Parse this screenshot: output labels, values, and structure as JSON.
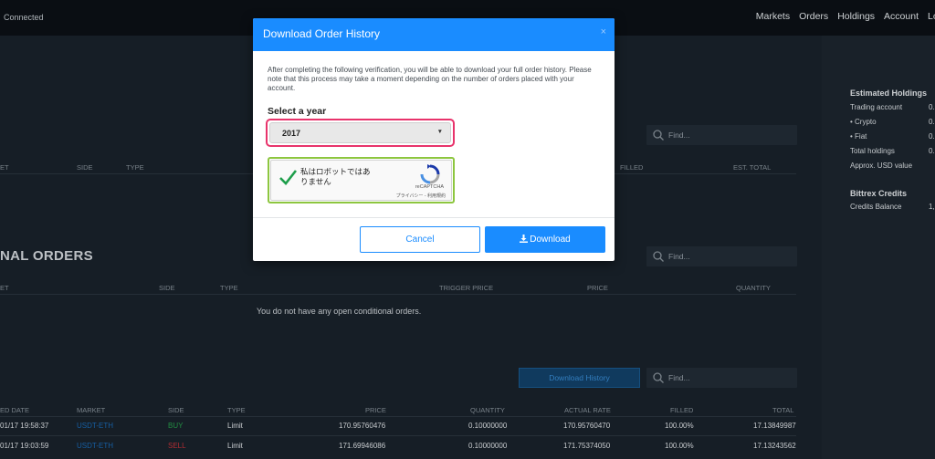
{
  "header": {
    "status": "Connected",
    "nav": [
      "Markets",
      "Orders",
      "Holdings",
      "Account",
      "Lo"
    ]
  },
  "open_orders": {
    "search_placeholder": "Find...",
    "columns": [
      "ET",
      "SIDE",
      "TYPE",
      "FILLED",
      "EST. TOTAL"
    ]
  },
  "conditional_orders": {
    "title": "NAL ORDERS",
    "search_placeholder": "Find...",
    "columns": [
      "ET",
      "SIDE",
      "TYPE",
      "TRIGGER PRICE",
      "PRICE",
      "QUANTITY"
    ],
    "empty": "You do not have any open conditional orders."
  },
  "history": {
    "download_label": "Download History",
    "search_placeholder": "Find...",
    "columns": [
      "ED DATE",
      "MARKET",
      "SIDE",
      "TYPE",
      "PRICE",
      "QUANTITY",
      "ACTUAL RATE",
      "FILLED",
      "TOTAL"
    ],
    "rows": [
      {
        "date": "01/17 19:58:37",
        "market": "USDT-ETH",
        "side": "BUY",
        "type": "Limit",
        "price": "170.95760476",
        "quantity": "0.10000000",
        "rate": "170.95760470",
        "filled": "100.00%",
        "total": "17.13849987"
      },
      {
        "date": "01/17 19:03:59",
        "market": "USDT-ETH",
        "side": "SELL",
        "type": "Limit",
        "price": "171.69946086",
        "quantity": "0.10000000",
        "rate": "171.75374050",
        "filled": "100.00%",
        "total": "17.13243562"
      }
    ]
  },
  "right_panel": {
    "holdings_title": "Estimated Holdings",
    "holdings": [
      {
        "label": "Trading account",
        "value": "0."
      },
      {
        "label": "• Crypto",
        "value": "0."
      },
      {
        "label": "• Fiat",
        "value": "0."
      },
      {
        "label": "Total holdings",
        "value": "0."
      },
      {
        "label": "Approx. USD value",
        "value": ""
      }
    ],
    "credits_title": "Bittrex Credits",
    "credits": [
      {
        "label": "Credits Balance",
        "value": "1,"
      }
    ]
  },
  "modal": {
    "title": "Download Order History",
    "close": "×",
    "description": "After completing the following verification, you will be able to download your full order history. Please note that this process may take a moment depending on the number of orders placed with your account.",
    "select_label": "Select a year",
    "select_value": "2017",
    "captcha_text": "私はロボットではありません",
    "captcha_brand": "reCAPTCHA",
    "captcha_links": "プライバシー - 利用規約",
    "cancel_label": "Cancel",
    "download_label": "Download"
  },
  "colors": {
    "accent": "#1a8cff",
    "buy": "#27a04b",
    "sell": "#c8333a",
    "highlight_select": "#e8336b",
    "highlight_captcha": "#8dc63f"
  },
  "icons": [
    "search-icon",
    "close-icon",
    "chevron-down-icon",
    "checkmark-icon",
    "recaptcha-logo-icon",
    "download-icon"
  ]
}
